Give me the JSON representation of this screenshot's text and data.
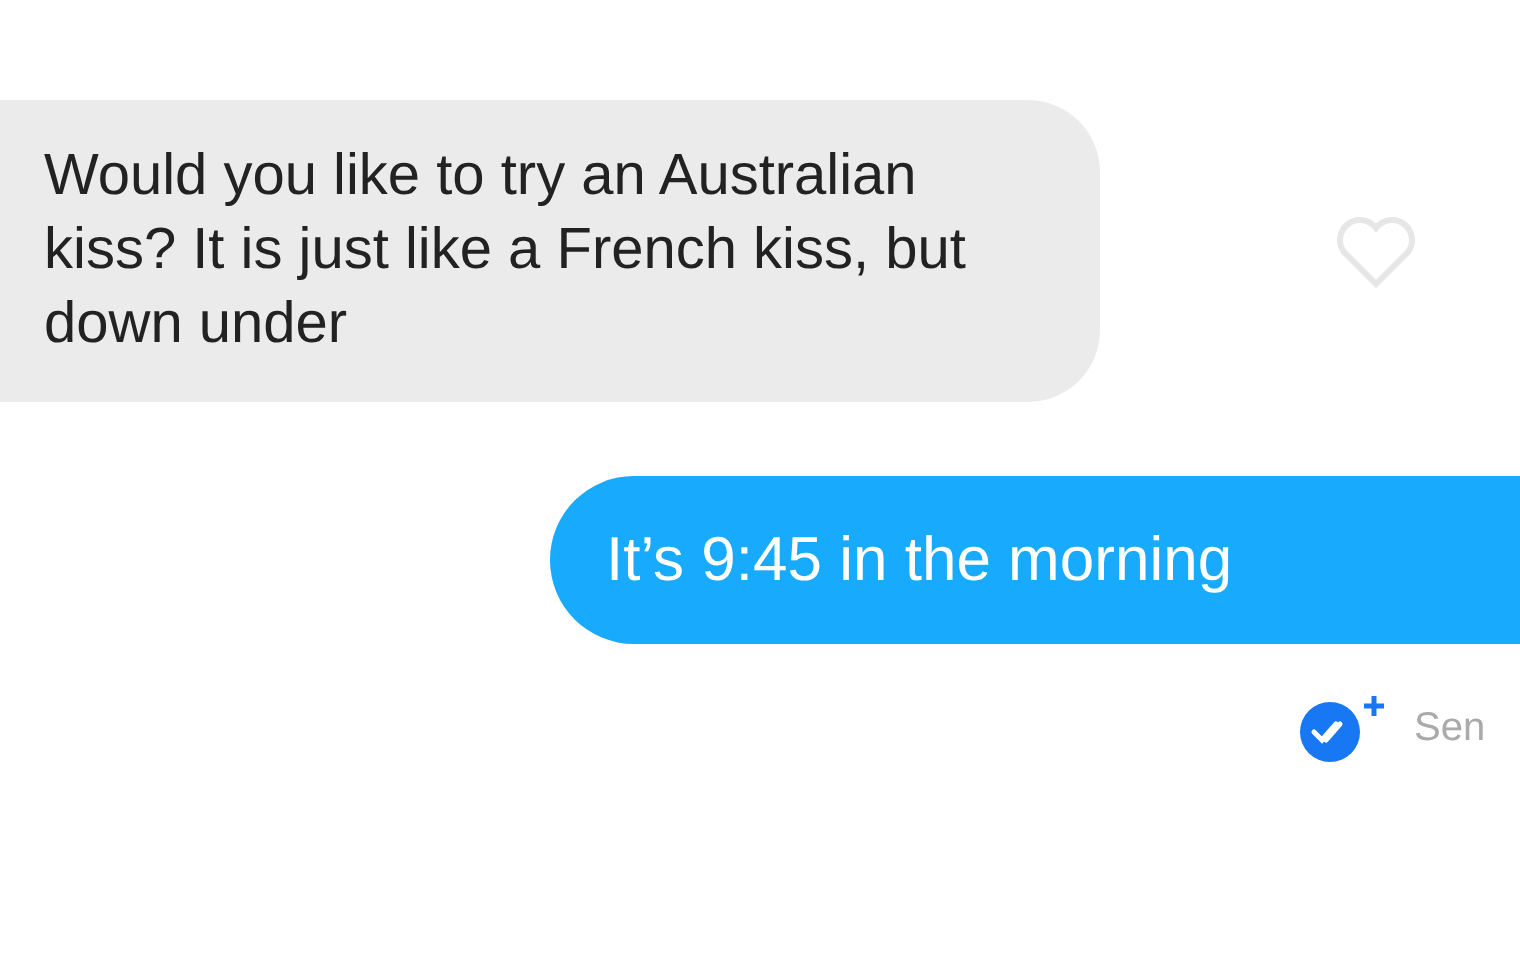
{
  "messages": [
    {
      "kind": "received",
      "text": "Would you like to try an Australian kiss? It is just like a French kiss, but down under",
      "liked": false
    },
    {
      "kind": "sent",
      "text": "It’s 9:45 in the morning",
      "status": "Sen"
    }
  ]
}
